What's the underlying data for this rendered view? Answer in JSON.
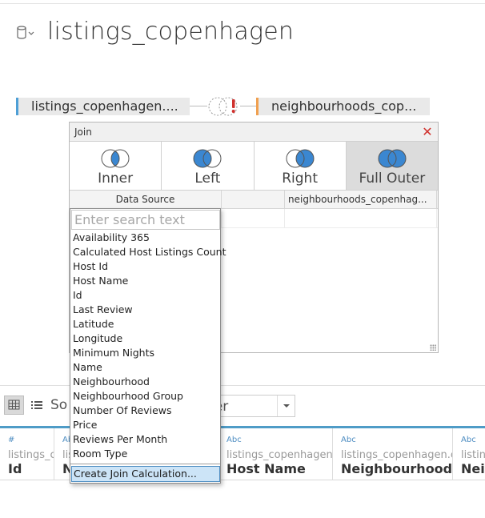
{
  "title": "listings_copenhagen",
  "join_canvas": {
    "left_table": "listings_copenhagen....",
    "right_table": "neighbourhoods_cop..."
  },
  "join_dialog": {
    "title": "Join",
    "types": [
      "Inner",
      "Left",
      "Right",
      "Full Outer"
    ],
    "selected_type": "Full Outer",
    "left_column_header": "Data Source",
    "right_column_header": "neighbourhoods_copenhag..."
  },
  "field_picker": {
    "search_placeholder": "Enter search text",
    "fields": [
      "Availability 365",
      "Calculated Host Listings Count",
      "Host Id",
      "Host Name",
      "Id",
      "Last Review",
      "Latitude",
      "Longitude",
      "Minimum Nights",
      "Name",
      "Neighbourhood",
      "Neighbourhood Group",
      "Number Of Reviews",
      "Price",
      "Reviews Per Month",
      "Room Type"
    ],
    "create_calc_label": "Create Join Calculation..."
  },
  "toolbar": {
    "sort_label": "So",
    "sort_dropdown_value": "der"
  },
  "grid_columns": [
    {
      "type": "#",
      "source": "listings_c",
      "name": "Id"
    },
    {
      "type": "Abc",
      "source": "lis",
      "name": "N"
    },
    {
      "type": "Abc",
      "source": "listings_copenhagen.cs",
      "name": "Host Name"
    },
    {
      "type": "Abc",
      "source": "listings_copenhagen.csv",
      "name": "Neighbourhood G"
    },
    {
      "type": "Abc",
      "source": "listing",
      "name": "Neig"
    }
  ],
  "colors": {
    "left_accent": "#4e9fd6",
    "right_accent": "#f0a050",
    "venn_fill": "#3b87d1",
    "selected_bg": "#dcdcdc",
    "highlight": "#cce4f7",
    "warning": "#d0312d"
  }
}
